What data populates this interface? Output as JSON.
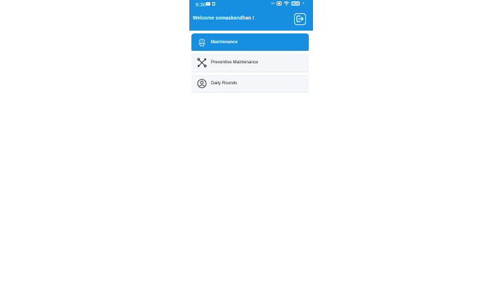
{
  "status_bar": {
    "time": "6:30",
    "signal_label": "4G",
    "battery_level": "58",
    "icons": [
      "youtube-icon",
      "storage-icon",
      "signal-icon",
      "sim-icon",
      "wifi-icon",
      "battery-icon",
      "charging-icon"
    ]
  },
  "header": {
    "welcome_text": "Welcome somaskandhan !",
    "logout_icon": "logout-icon",
    "background_color": "#168fe0"
  },
  "menu": {
    "items": [
      {
        "label": "Maintenance",
        "icon": "robot-icon",
        "active": true
      },
      {
        "label": "Preventive Maintenance",
        "icon": "tools-icon",
        "active": false
      },
      {
        "label": "Daily Rounds",
        "icon": "user-circle-icon",
        "active": false
      }
    ]
  },
  "colors": {
    "primary": "#168fe0",
    "item_background": "#f4f6fa",
    "text": "#222222"
  }
}
